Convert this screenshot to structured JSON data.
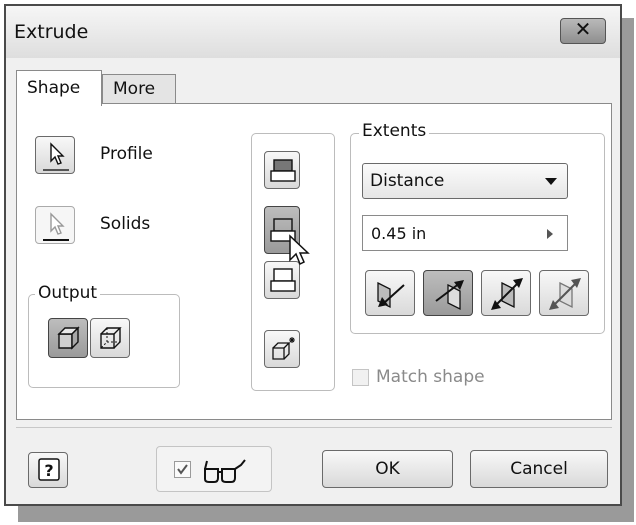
{
  "dialog": {
    "title": "Extrude",
    "close_label": "✕"
  },
  "tabs": [
    {
      "label": "Shape",
      "active": true
    },
    {
      "label": "More",
      "active": false
    }
  ],
  "shape_panel": {
    "profile_label": "Profile",
    "solids_label": "Solids",
    "output_legend": "Output",
    "output_buttons": [
      {
        "name": "solid-output",
        "icon": "solid-cube-icon",
        "pressed": true
      },
      {
        "name": "surface-output",
        "icon": "surface-cube-icon",
        "pressed": false
      }
    ],
    "operation_buttons": [
      {
        "name": "join",
        "icon": "join-icon",
        "pressed": false
      },
      {
        "name": "cut",
        "icon": "cut-icon",
        "pressed": true
      },
      {
        "name": "intersect",
        "icon": "intersect-icon",
        "pressed": false
      },
      {
        "name": "new-solid",
        "icon": "new-solid-icon",
        "pressed": false
      }
    ],
    "extents_legend": "Extents",
    "extents_type": "Distance",
    "distance_value": "0.45 in",
    "direction_buttons": [
      {
        "name": "direction-1",
        "icon": "direction-flip-icon",
        "pressed": false
      },
      {
        "name": "direction-2",
        "icon": "direction-default-icon",
        "pressed": true
      },
      {
        "name": "symmetric",
        "icon": "symmetric-icon",
        "pressed": false
      },
      {
        "name": "asymmetric",
        "icon": "asymmetric-icon",
        "pressed": false
      }
    ],
    "match_shape_label": "Match shape",
    "match_shape_checked": false
  },
  "footer": {
    "help_icon": "help-icon",
    "preview_checked": true,
    "preview_icon": "glasses-icon",
    "ok_label": "OK",
    "cancel_label": "Cancel"
  }
}
